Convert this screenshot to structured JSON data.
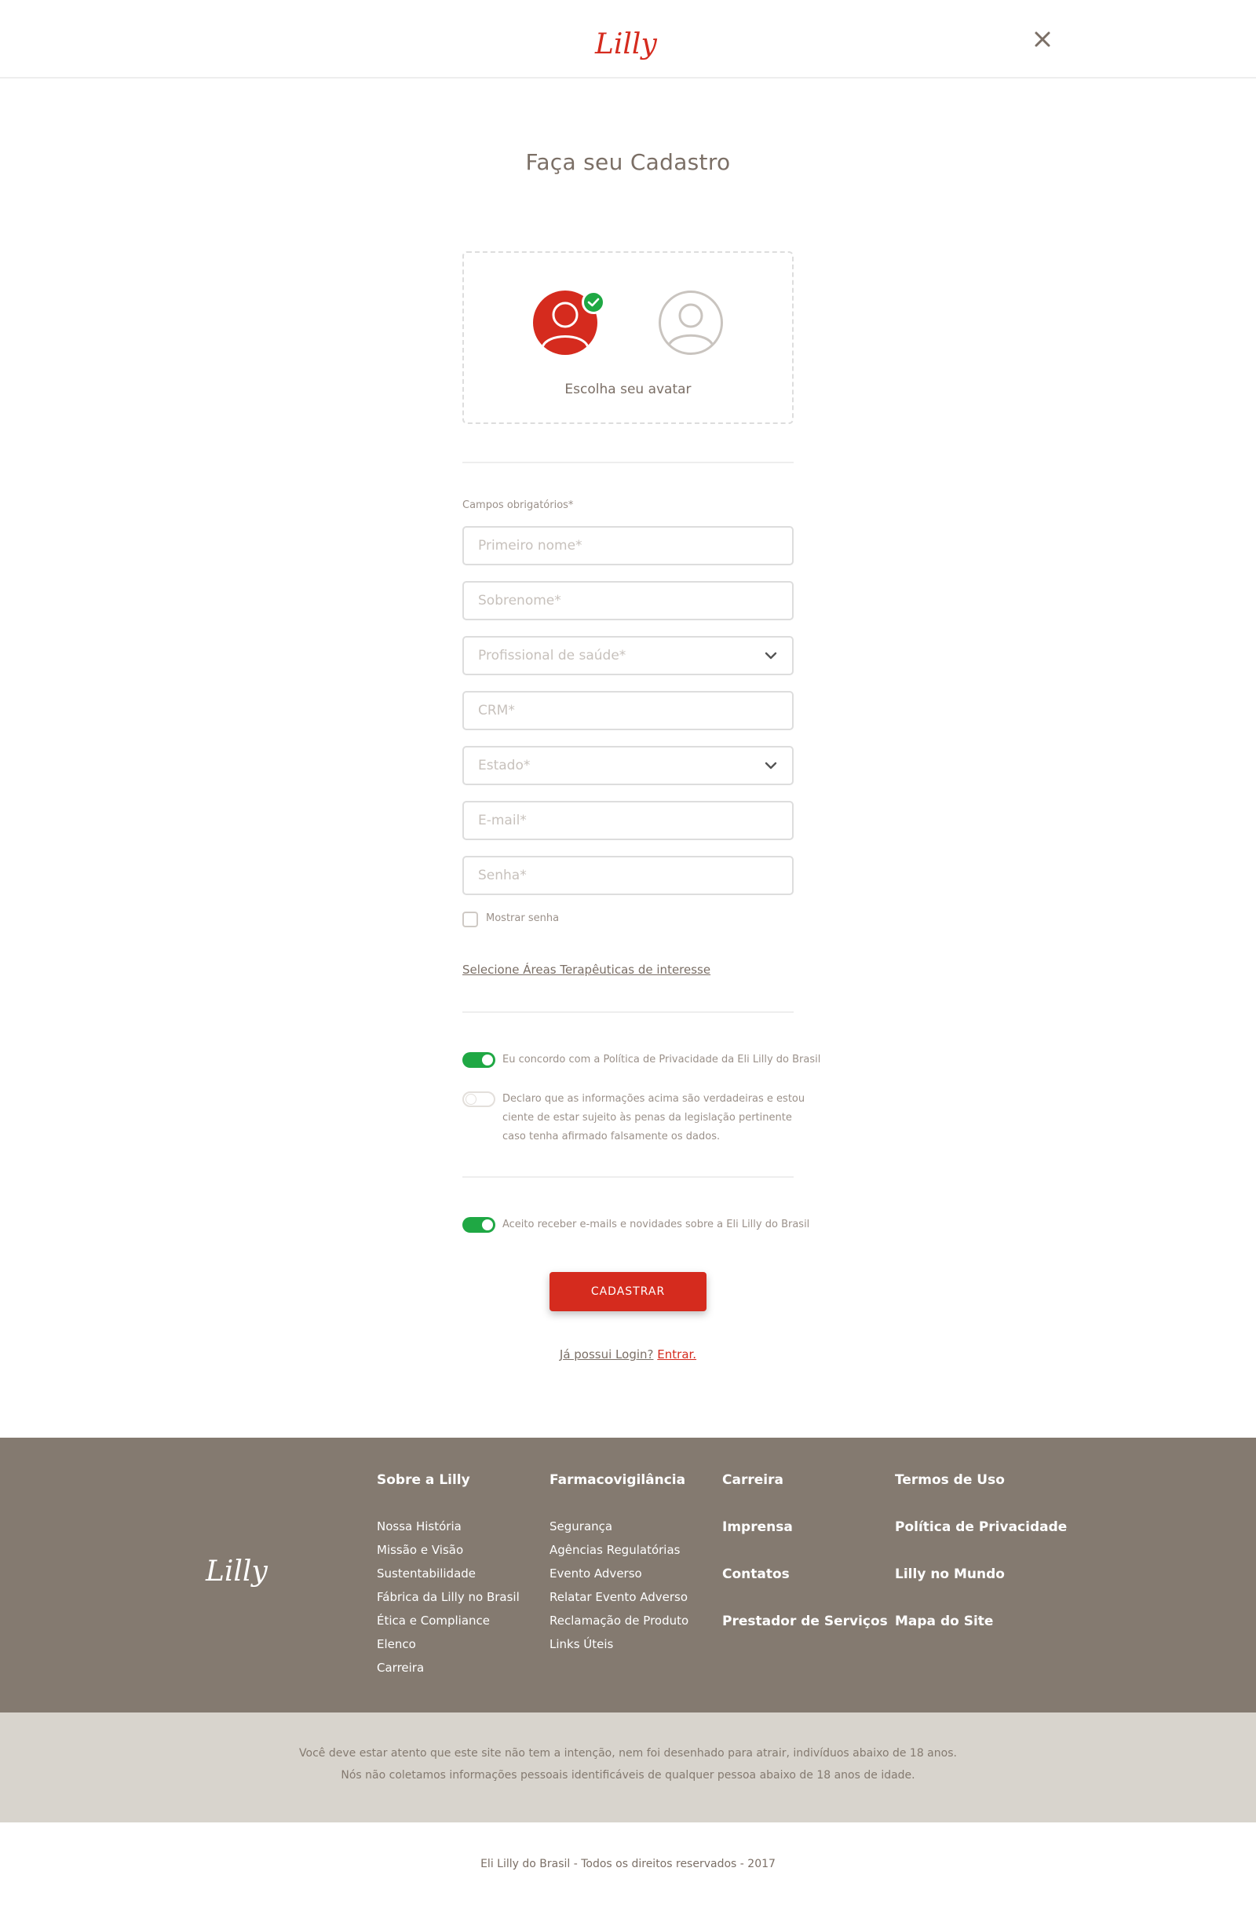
{
  "header": {
    "logo_text": "Lilly",
    "close_label": "×"
  },
  "page_title": "Faça seu Cadastro",
  "avatar": {
    "label": "Escolha seu avatar",
    "selected": "red-avatar"
  },
  "form": {
    "required_label": "Campos obrigatórios*",
    "first_name_placeholder": "Primeiro nome*",
    "last_name_placeholder": "Sobrenome*",
    "profession_placeholder": "Profissional de saúde*",
    "crm_placeholder": "CRM*",
    "state_placeholder": "Estado*",
    "email_placeholder": "E-mail*",
    "password_placeholder": "Senha*",
    "show_password_label": "Mostrar senha",
    "areas_link": "Selecione Áreas Terapêuticas de interesse",
    "privacy_toggle": {
      "label": "Eu concordo com a Política de Privacidade da Eli Lilly do Brasil",
      "on": true
    },
    "declaration_toggle": {
      "lines": [
        "Declaro que as informações acima são verdadeiras e estou",
        "ciente de estar sujeito às penas da legislação pertinente",
        "caso tenha afirmado falsamente os dados."
      ],
      "on": false
    },
    "emails_toggle": {
      "label": "Aceito receber e-mails e novidades sobre a Eli Lilly do Brasil",
      "on": true
    },
    "submit_label": "CADASTRAR",
    "login_question": "Já possui Login?",
    "login_link": "Entrar."
  },
  "footer": {
    "logo_text": "Lilly",
    "col1": {
      "heading": "Sobre a Lilly",
      "items": [
        "Nossa História",
        "Missão e Visão",
        "Sustentabilidade",
        "Fábrica da Lilly no Brasil",
        "Ética e Compliance",
        "Elenco",
        "Carreira"
      ]
    },
    "col2": {
      "heading": "Farmacovigilância",
      "items": [
        "Segurança",
        "Agências Regulatórias",
        "Evento Adverso",
        "Relatar Evento Adverso",
        "Reclamação de Produto",
        "Links Úteis"
      ]
    },
    "col3": {
      "items": [
        "Carreira",
        "Imprensa",
        "Contatos",
        "Prestador de Serviços"
      ]
    },
    "col4": {
      "items": [
        "Termos de Uso",
        "Política de Privacidade",
        "Lilly no Mundo",
        "Mapa do Site"
      ]
    }
  },
  "disclaimer": {
    "line1": "Você deve estar atento que este site não tem a intenção, nem foi desenhado para atrair, indivíduos abaixo de 18 anos.",
    "line2": "Nós não coletamos informações pessoais identificáveis de qualquer pessoa abaixo de 18 anos de idade."
  },
  "copyright": "Eli Lilly do Brasil - Todos os direitos reservados - 2017",
  "colors": {
    "brand_red": "#d52b1e",
    "toggle_green": "#1fa844",
    "footer_bg": "#847a70",
    "disclaimer_bg": "#d8d4cd"
  }
}
